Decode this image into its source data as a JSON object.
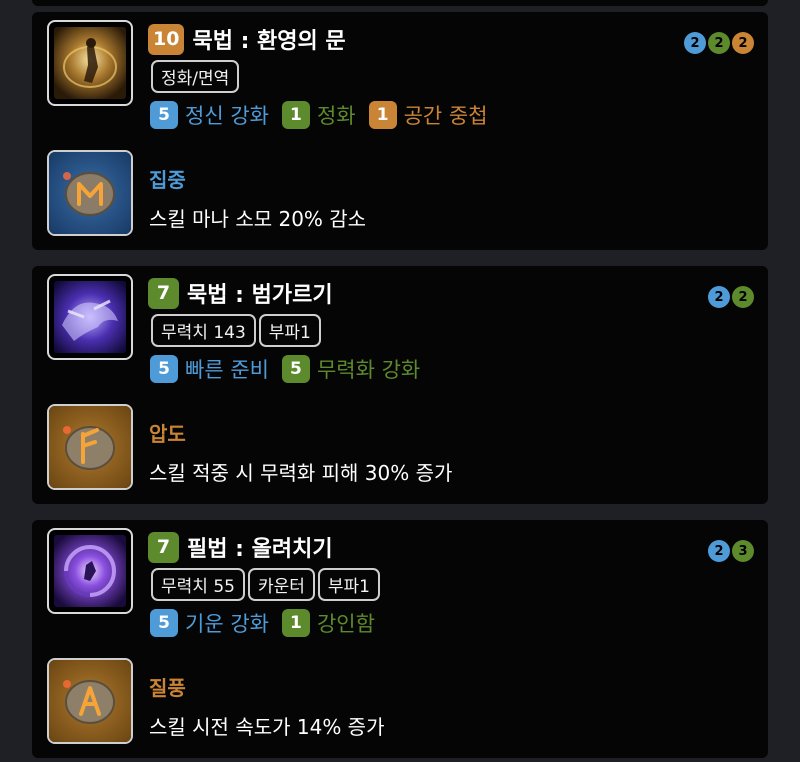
{
  "colors": {
    "blue": "#4f9bd8",
    "green": "#5c8a2c",
    "orange": "#c98436",
    "rune_gold": "#c98436"
  },
  "skills": [
    {
      "level": "10",
      "level_color": "#c98436",
      "name": "묵법 : 환영의 문",
      "icon": "skill-icon-phantom-gate",
      "tags": [
        "정화/면역"
      ],
      "dots": [
        {
          "value": "2",
          "color": "#4f9bd8"
        },
        {
          "value": "2",
          "color": "#5c8a2c"
        },
        {
          "value": "2",
          "color": "#c98436"
        }
      ],
      "tripods": [
        {
          "level": "5",
          "name": "정신 강화",
          "color": "#4f9bd8"
        },
        {
          "level": "1",
          "name": "정화",
          "color": "#5c8a2c"
        },
        {
          "level": "1",
          "name": "공간 중첩",
          "color": "#c98436"
        }
      ],
      "rune": {
        "name": "집중",
        "color": "#4f9bd8",
        "desc": "스킬 마나 소모 20% 감소",
        "icon": "rune-focus-icon"
      }
    },
    {
      "level": "7",
      "level_color": "#5c8a2c",
      "name": "묵법 : 범가르기",
      "icon": "skill-icon-tiger-split",
      "tags": [
        "무력치 143",
        "부파1"
      ],
      "dots": [
        {
          "value": "2",
          "color": "#4f9bd8"
        },
        {
          "value": "2",
          "color": "#5c8a2c"
        }
      ],
      "tripods": [
        {
          "level": "5",
          "name": "빠른 준비",
          "color": "#4f9bd8"
        },
        {
          "level": "5",
          "name": "무력화 강화",
          "color": "#5c8a2c"
        }
      ],
      "rune": {
        "name": "압도",
        "color": "#c98436",
        "desc": "스킬 적중 시 무력화 피해 30% 증가",
        "icon": "rune-overwhelm-icon"
      }
    },
    {
      "level": "7",
      "level_color": "#5c8a2c",
      "name": "필법 : 올려치기",
      "icon": "skill-icon-upper-strike",
      "tags": [
        "무력치 55",
        "카운터",
        "부파1"
      ],
      "dots": [
        {
          "value": "2",
          "color": "#4f9bd8"
        },
        {
          "value": "3",
          "color": "#5c8a2c"
        }
      ],
      "tripods": [
        {
          "level": "5",
          "name": "기운 강화",
          "color": "#4f9bd8"
        },
        {
          "level": "1",
          "name": "강인함",
          "color": "#5c8a2c"
        }
      ],
      "rune": {
        "name": "질풍",
        "color": "#c98436",
        "desc": "스킬 시전 속도가 14% 증가",
        "icon": "rune-gale-icon"
      }
    }
  ]
}
